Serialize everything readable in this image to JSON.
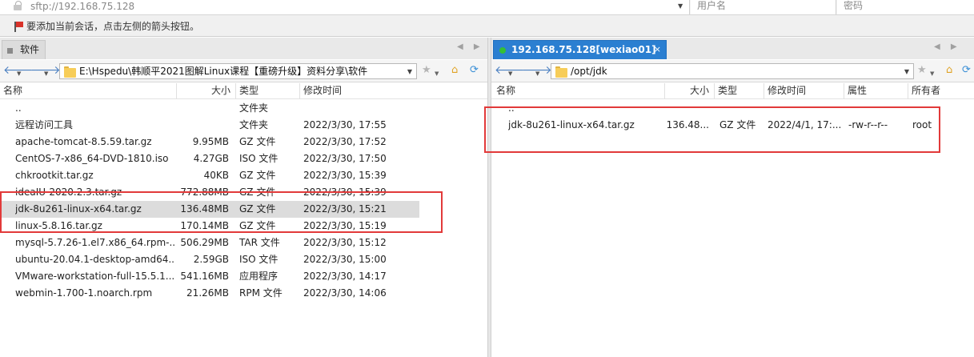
{
  "connection": {
    "url": "sftp://192.168.75.128",
    "username_placeholder": "用户名",
    "password_placeholder": "密码"
  },
  "hint": {
    "text": "要添加当前会话，点击左侧的箭头按钮。"
  },
  "tabs": {
    "left": {
      "label": "软件"
    },
    "right": {
      "label": "192.168.75.128[wexiao01]",
      "close": "×"
    },
    "nav": "◀ ▶"
  },
  "left_pane": {
    "path": "E:\\Hspedu\\韩顺平2021图解Linux课程【重磅升级】资料分享\\软件",
    "columns": {
      "name": "名称",
      "size": "大小",
      "type": "类型",
      "modified": "修改时间"
    },
    "rows": [
      {
        "icon": "folder",
        "name": "..",
        "size": "",
        "type": "文件夹",
        "modified": ""
      },
      {
        "icon": "folder",
        "name": "远程访问工具",
        "size": "",
        "type": "文件夹",
        "modified": "2022/3/30, 17:55"
      },
      {
        "icon": "file",
        "name": "apache-tomcat-8.5.59.tar.gz",
        "size": "9.95MB",
        "type": "GZ 文件",
        "modified": "2022/3/30, 17:52"
      },
      {
        "icon": "file",
        "name": "CentOS-7-x86_64-DVD-1810.iso",
        "size": "4.27GB",
        "type": "ISO 文件",
        "modified": "2022/3/30, 17:50"
      },
      {
        "icon": "file",
        "name": "chkrootkit.tar.gz",
        "size": "40KB",
        "type": "GZ 文件",
        "modified": "2022/3/30, 15:39"
      },
      {
        "icon": "file",
        "name": "ideaIU-2020.2.3.tar.gz",
        "size": "772.88MB",
        "type": "GZ 文件",
        "modified": "2022/3/30, 15:39"
      },
      {
        "icon": "file",
        "name": "jdk-8u261-linux-x64.tar.gz",
        "size": "136.48MB",
        "type": "GZ 文件",
        "modified": "2022/3/30, 15:21",
        "selected": true
      },
      {
        "icon": "file",
        "name": "linux-5.8.16.tar.gz",
        "size": "170.14MB",
        "type": "GZ 文件",
        "modified": "2022/3/30, 15:19"
      },
      {
        "icon": "file",
        "name": "mysql-5.7.26-1.el7.x86_64.rpm-...",
        "size": "506.29MB",
        "type": "TAR 文件",
        "modified": "2022/3/30, 15:12"
      },
      {
        "icon": "file",
        "name": "ubuntu-20.04.1-desktop-amd64...",
        "size": "2.59GB",
        "type": "ISO 文件",
        "modified": "2022/3/30, 15:00"
      },
      {
        "icon": "app",
        "name": "VMware-workstation-full-15.5.1...",
        "size": "541.16MB",
        "type": "应用程序",
        "modified": "2022/3/30, 14:17"
      },
      {
        "icon": "file",
        "name": "webmin-1.700-1.noarch.rpm",
        "size": "21.26MB",
        "type": "RPM 文件",
        "modified": "2022/3/30, 14:06"
      }
    ]
  },
  "right_pane": {
    "path": "/opt/jdk",
    "columns": {
      "name": "名称",
      "size": "大小",
      "type": "类型",
      "modified": "修改时间",
      "attrs": "属性",
      "owner": "所有者"
    },
    "rows": [
      {
        "icon": "folder",
        "name": "..",
        "size": "",
        "type": "",
        "modified": "",
        "attrs": "",
        "owner": ""
      },
      {
        "icon": "file",
        "name": "jdk-8u261-linux-x64.tar.gz",
        "size": "136.48...",
        "type": "GZ 文件",
        "modified": "2022/4/1, 17:...",
        "attrs": "-rw-r--r--",
        "owner": "root"
      }
    ]
  },
  "colors": {
    "tab_active": "#2b7fd1",
    "selection": "#dcdcdc",
    "annotation": "#e23a3a",
    "folder": "#f7cd59"
  }
}
